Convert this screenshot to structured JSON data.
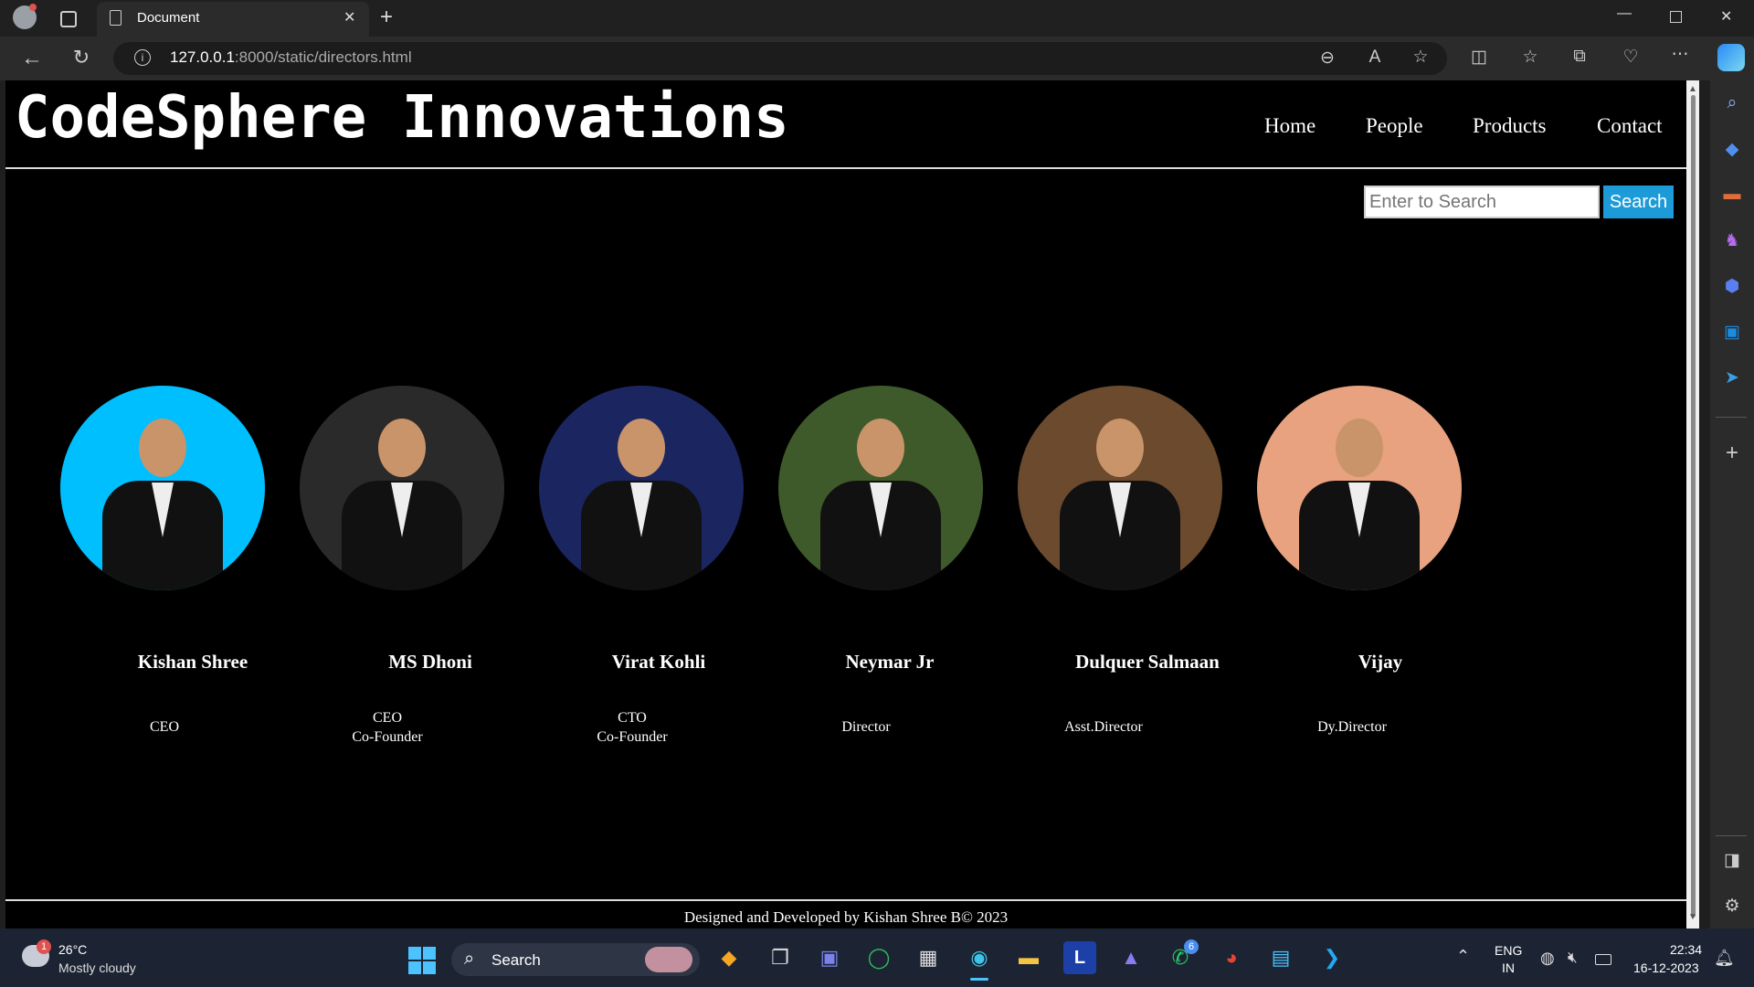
{
  "browser": {
    "tab_title": "Document",
    "url_host": "127.0.0.1",
    "url_rest": ":8000/static/directors.html"
  },
  "site": {
    "brand": "CodeSphere Innovations",
    "nav": [
      "Home",
      "People",
      "Products",
      "Contact"
    ],
    "search_placeholder": "Enter to Search",
    "search_button": "Search",
    "footer": "Designed and Developed by Kishan Shree B© 2023"
  },
  "people": [
    {
      "name": "Kishan Shree",
      "role": "CEO",
      "bg": "#00bfff"
    },
    {
      "name": "MS Dhoni",
      "role": "CEO\nCo-Founder",
      "bg": "#2a2a2a"
    },
    {
      "name": "Virat Kohli",
      "role": "CTO\nCo-Founder",
      "bg": "#1b2560"
    },
    {
      "name": "Neymar Jr",
      "role": "Director",
      "bg": "#3f5a2a"
    },
    {
      "name": "Dulquer Salmaan",
      "role": "Asst.Director",
      "bg": "#6b4a2e"
    },
    {
      "name": "Vijay",
      "role": "Dy.Director",
      "bg": "#e8a27f"
    }
  ],
  "taskbar": {
    "weather_temp": "26°C",
    "weather_desc": "Mostly cloudy",
    "weather_badge": "1",
    "search_label": "Search",
    "whatsapp_badge": "6",
    "lang_top": "ENG",
    "lang_bottom": "IN",
    "time": "22:34",
    "date": "16-12-2023"
  }
}
